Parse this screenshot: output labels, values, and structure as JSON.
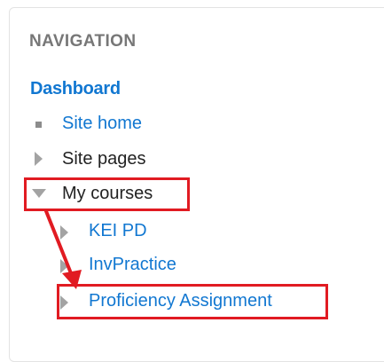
{
  "navigation": {
    "title": "NAVIGATION",
    "dashboard": "Dashboard",
    "items": [
      {
        "label": "Site home"
      },
      {
        "label": "Site pages"
      },
      {
        "label": "My courses"
      }
    ],
    "courses": [
      {
        "label": "KEI PD"
      },
      {
        "label": "InvPractice"
      },
      {
        "label": "Proficiency Assignment"
      }
    ]
  },
  "colors": {
    "link": "#1177d1",
    "heading": "#777777",
    "annotation": "#e11b22"
  },
  "annotation": {
    "type": "red-highlight-with-arrow",
    "from": "My courses",
    "to": "Proficiency Assignment"
  }
}
